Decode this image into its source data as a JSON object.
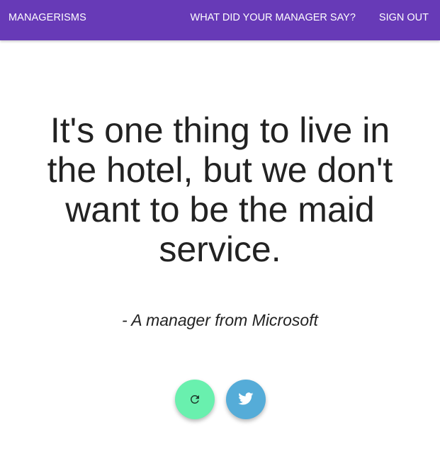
{
  "navbar": {
    "brand": "MANAGERISMS",
    "links": [
      {
        "label": "WHAT DID YOUR MANAGER SAY?"
      },
      {
        "label": "SIGN OUT"
      }
    ],
    "color": "#673ab7"
  },
  "main": {
    "quote": "It's one thing to live in the hotel, but we don't want to be the maid service.",
    "attribution": "- A manager from Microsoft"
  },
  "actions": {
    "refresh_icon": "refresh-icon",
    "refresh_color": "#69f0ae",
    "twitter_icon": "twitter-icon",
    "twitter_color": "#55acd8"
  }
}
